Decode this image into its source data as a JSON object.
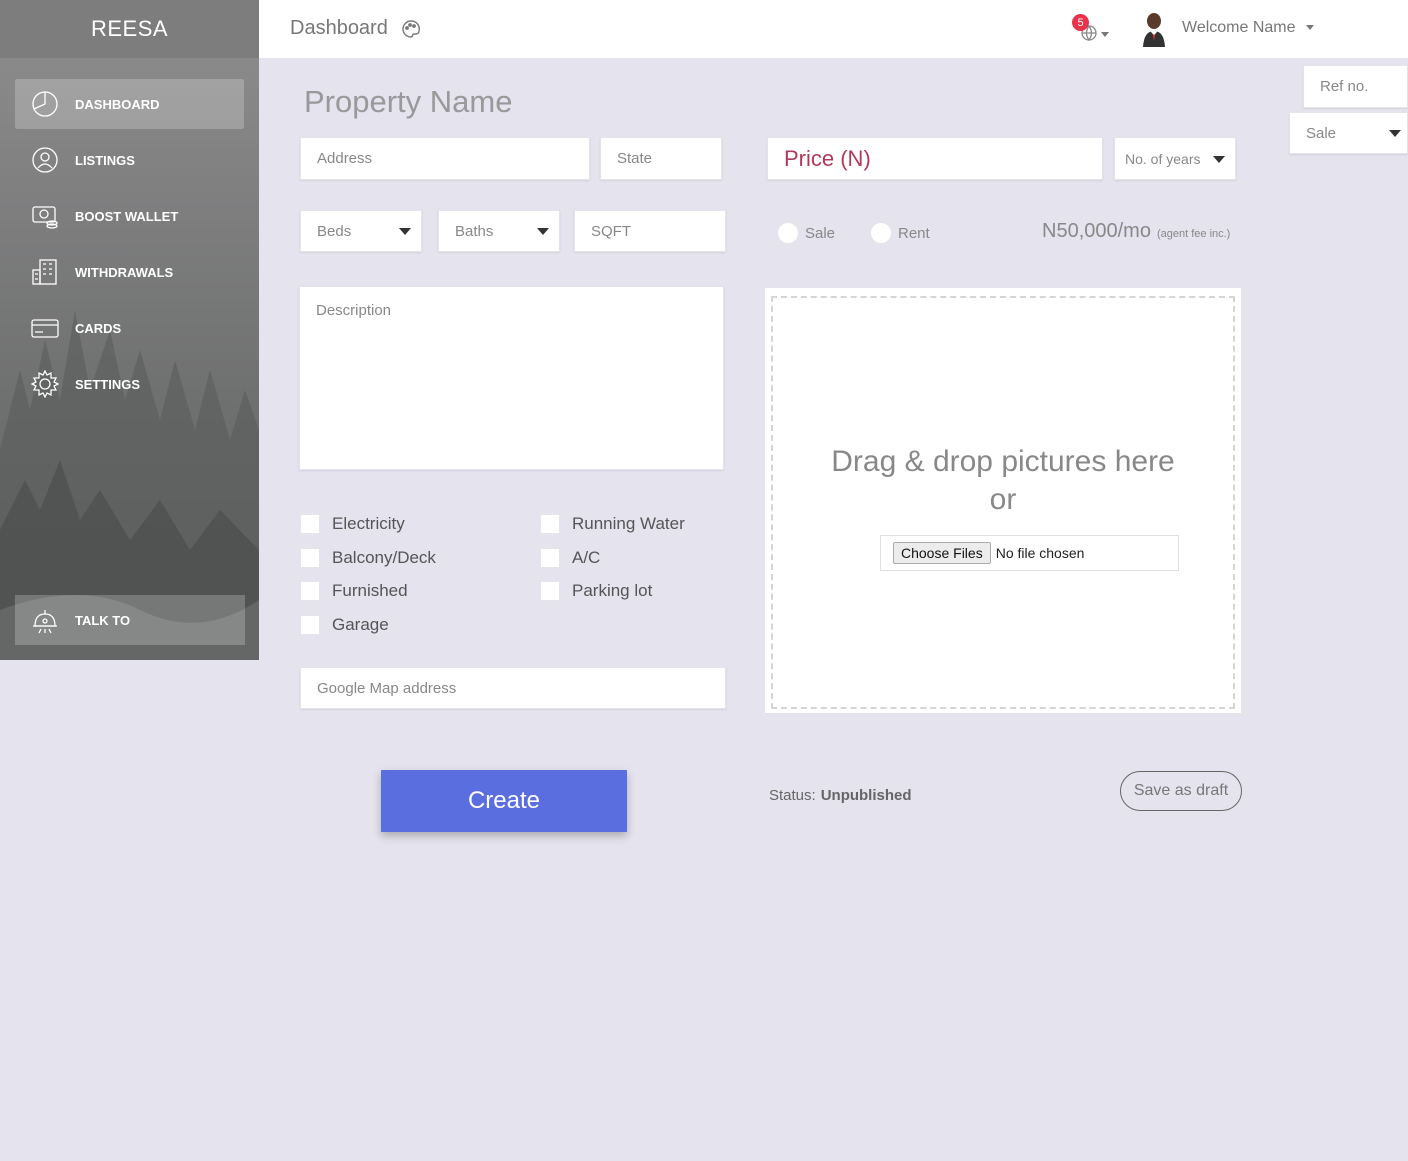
{
  "app": {
    "brand": "REESA"
  },
  "sidebar": {
    "items": [
      {
        "label": "DASHBOARD",
        "icon": "pie-chart-icon",
        "active": true
      },
      {
        "label": "LISTINGS",
        "icon": "user-circle-icon"
      },
      {
        "label": "BOOST WALLET",
        "icon": "wallet-icon"
      },
      {
        "label": "WITHDRAWALS",
        "icon": "building-icon"
      },
      {
        "label": "CARDS",
        "icon": "credit-card-icon"
      },
      {
        "label": "SETTINGS",
        "icon": "gear-icon"
      }
    ],
    "talk_label": "TALK TO"
  },
  "header": {
    "title": "Dashboard",
    "notifications_count": "5",
    "welcome": "Welcome Name"
  },
  "form": {
    "heading": "Property Name",
    "address_placeholder": "Address",
    "state_placeholder": "State",
    "price_placeholder": "Price (N)",
    "years_placeholder": "No. of years",
    "beds_placeholder": "Beds",
    "baths_placeholder": "Baths",
    "sqft_placeholder": "SQFT",
    "sale_radio": "Sale",
    "rent_radio": "Rent",
    "price_display": "N50,000/mo",
    "price_note": "(agent fee inc.)",
    "description_placeholder": "Description",
    "amenities_left": [
      "Electricity",
      "Balcony/Deck",
      "Furnished",
      "Garage"
    ],
    "amenities_right": [
      "Running Water",
      "A/C",
      "Parking lot"
    ],
    "map_placeholder": "Google Map address",
    "dropzone_line1": "Drag & drop pictures here",
    "dropzone_line2": "or",
    "choose_files": "Choose Files",
    "no_file": "No file chosen",
    "create_label": "Create",
    "status_label": "Status:",
    "status_value": "Unpublished",
    "draft_label": "Save as draft"
  },
  "right_panel": {
    "ref_placeholder": "Ref no.",
    "type_value": "Sale"
  },
  "colors": {
    "accent": "#5a6ee0",
    "price": "#b03a5b",
    "badge": "#e8334a"
  }
}
